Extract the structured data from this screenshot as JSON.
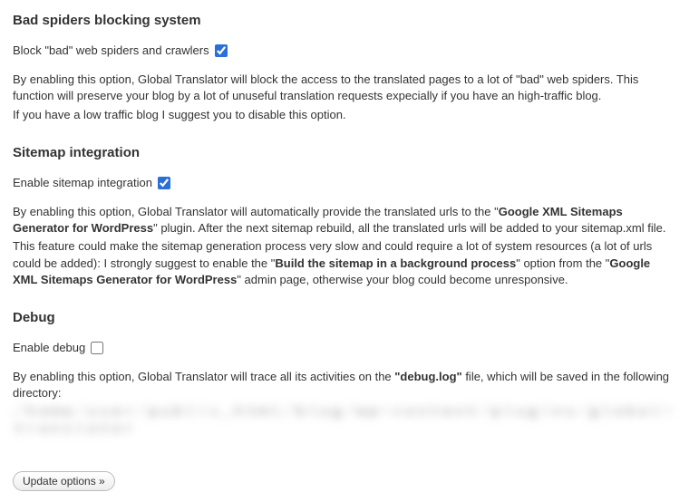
{
  "sections": {
    "spiders": {
      "heading": "Bad spiders blocking system",
      "option_label": "Block \"bad\" web spiders and crawlers",
      "checked": true,
      "desc_line1": "By enabling this option, Global Translator will block the access to the translated pages to a lot of \"bad\" web spiders. This function will preserve your blog by a lot of unuseful translation requests expecially if you have an high-traffic blog.",
      "desc_line2": "If you have a low traffic blog I suggest you to disable this option."
    },
    "sitemap": {
      "heading": "Sitemap integration",
      "option_label": "Enable sitemap integration",
      "checked": true,
      "desc_line1_pre": "By enabling this option, Global Translator will automatically provide the translated urls to the \"",
      "desc_line1_bold": "Google XML Sitemaps Generator for WordPress",
      "desc_line1_post": "\" plugin. After the next sitemap rebuild, all the translated urls will be added to your sitemap.xml file.",
      "desc_line2_pre": "This feature could make the sitemap generation process very slow and could require a lot of system resources (a lot of urls could be added): I strongly suggest to enable the \"",
      "desc_line2_bold1": "Build the sitemap in a background process",
      "desc_line2_mid": "\" option from the \"",
      "desc_line2_bold2": "Google XML Sitemaps Generator for WordPress",
      "desc_line2_post": "\" admin page, otherwise your blog could become unresponsive."
    },
    "debug": {
      "heading": "Debug",
      "option_label": "Enable debug",
      "checked": false,
      "desc_pre": "By enabling this option, Global Translator will trace all its activities on the ",
      "desc_bold": "\"debug.log\"",
      "desc_post": " file, which will be saved in the following directory:",
      "path_obscured": "／ｈｏｍｅ／ｕｓｅｒ／ｐｕｂｌｉｃ＿ｈｔｍｌ／ｂｌｏｇ／ｗｐ－ｃｏｎｔｅｎｔ／ｐｌｕｇｉｎｓ／ｇｌｏｂａｌ－ｔｒａｎｓｌａｔｏｒ"
    }
  },
  "submit_label": "Update options »"
}
